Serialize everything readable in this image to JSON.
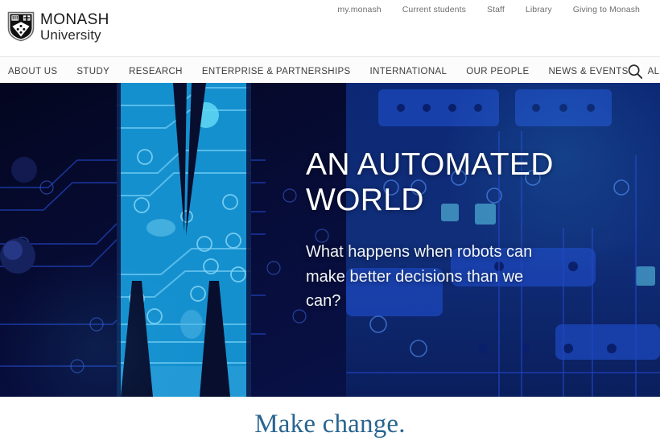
{
  "brand": {
    "name_line1": "MONASH",
    "name_line2": "University",
    "logo_icon": "monash-shield-icon",
    "accent_blue": "#006dae",
    "hero_cyan": "#1590cf",
    "hero_navy": "#05082a",
    "tagline_color": "#2a6590"
  },
  "utility_nav": {
    "items": [
      {
        "label": "my.monash"
      },
      {
        "label": "Current students"
      },
      {
        "label": "Staff"
      },
      {
        "label": "Library"
      },
      {
        "label": "Giving to Monash"
      }
    ]
  },
  "main_nav": {
    "items": [
      {
        "label": "ABOUT US"
      },
      {
        "label": "STUDY"
      },
      {
        "label": "RESEARCH"
      },
      {
        "label": "ENTERPRISE & PARTNERSHIPS"
      },
      {
        "label": "INTERNATIONAL"
      },
      {
        "label": "OUR PEOPLE"
      },
      {
        "label": "NEWS & EVENTS"
      },
      {
        "label": "ALUMNI"
      }
    ],
    "search_icon": "search-icon",
    "search_label": "Search"
  },
  "hero": {
    "title": "AN AUTOMATED WORLD",
    "subtitle": "What happens when robots can make better decisions than we can?",
    "background_description": "circuit-board-photograph"
  },
  "tagline": {
    "text": "Make change."
  }
}
